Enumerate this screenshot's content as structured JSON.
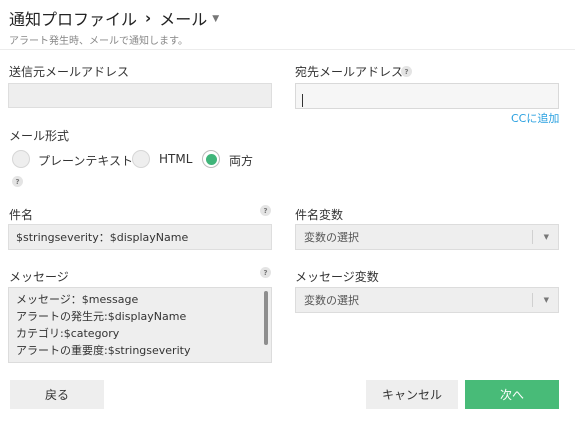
{
  "header": {
    "title": "通知プロファイル",
    "separator": "›",
    "subtitle_page": "メール",
    "caret": "▼",
    "description": "アラート発生時、メールで通知します。"
  },
  "form": {
    "from_label": "送信元メールアドレス",
    "from_value": "",
    "to_label": "宛先メールアドレス",
    "to_value": "",
    "cc_link": "CCに追加",
    "format_label": "メール形式",
    "format_options": [
      {
        "label": "プレーンテキスト",
        "selected": false
      },
      {
        "label": "HTML",
        "selected": false
      },
      {
        "label": "両方",
        "selected": true
      }
    ],
    "subject_label": "件名",
    "subject_value": "$stringseverity：$displayName",
    "subject_var_label": "件名変数",
    "subject_var_select": "変数の選択",
    "message_label": "メッセージ",
    "message_lines": [
      "メッセージ：$message",
      "アラートの発生元:$displayName",
      "カテゴリ:$category",
      "アラートの重要度:$stringseverity"
    ],
    "message_var_label": "メッセージ変数",
    "message_var_select": "変数の選択",
    "help_glyph": "?"
  },
  "footer": {
    "back": "戻る",
    "cancel": "キャンセル",
    "next": "次へ"
  },
  "colors": {
    "accent_green": "#48bb78",
    "link_blue": "#29a0e0",
    "field_bg": "#eeeeee"
  }
}
